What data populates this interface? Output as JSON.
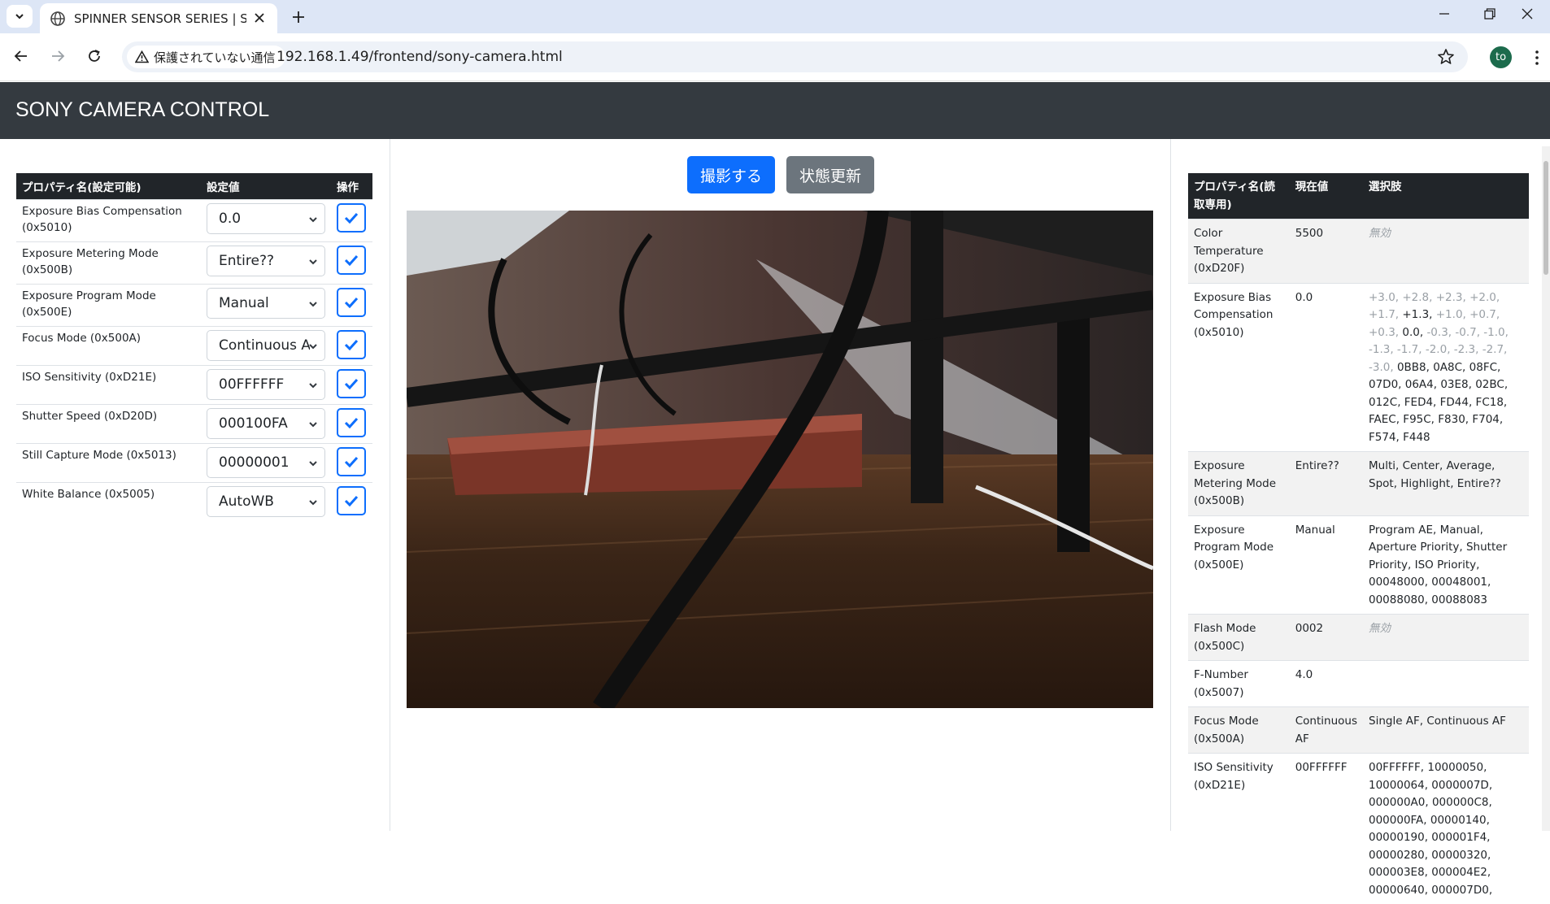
{
  "browser": {
    "tab_title": "SPINNER SENSOR SERIES | SONY CAMERA CONTROL",
    "security_text": "保護されていない通信",
    "url": "192.168.1.49/frontend/sony-camera.html",
    "profile_initials": "to"
  },
  "header": {
    "brand": "SONY CAMERA CONTROL"
  },
  "left_table": {
    "headers": {
      "name": "プロパティ名(設定可能)",
      "value": "設定値",
      "action": "操作"
    },
    "rows": [
      {
        "name": "Exposure Bias Compensation (0x5010)",
        "value": "0.0"
      },
      {
        "name": "Exposure Metering Mode (0x500B)",
        "value": "Entire??"
      },
      {
        "name": "Exposure Program Mode (0x500E)",
        "value": "Manual"
      },
      {
        "name": "Focus Mode (0x500A)",
        "value": "Continuous AF"
      },
      {
        "name": "ISO Sensitivity (0xD21E)",
        "value": "00FFFFFF"
      },
      {
        "name": "Shutter Speed (0xD20D)",
        "value": "000100FA"
      },
      {
        "name": "Still Capture Mode (0x5013)",
        "value": "00000001"
      },
      {
        "name": "White Balance (0x5005)",
        "value": "AutoWB"
      }
    ]
  },
  "buttons": {
    "capture": "撮影する",
    "refresh": "状態更新"
  },
  "right_table": {
    "headers": {
      "name": "プロパティ名(読取専用)",
      "current": "現在値",
      "options": "選択肢"
    },
    "disabled_text": "無効",
    "rows": [
      {
        "name": "Color Temperature (0xD20F)",
        "current": "5500"
      },
      {
        "name": "Exposure Bias Compensation (0x5010)",
        "current": "0.0",
        "options_dim_1": "+3.0, +2.8, +2.3, +2.0, +1.7,",
        "options_norm_1": "+1.3,",
        "options_dim_2": "+1.0, +0.7, +0.3,",
        "options_norm_2": "0.0,",
        "options_dim_3": "-0.3, -0.7, -1.0, -1.3, -1.7, -2.0, -2.3, -2.7, -3.0,",
        "options_norm_3": "0BB8, 0A8C, 08FC, 07D0, 06A4, 03E8, 02BC, 012C, FED4, FD44, FC18, FAEC, F95C, F830, F704, F574, F448"
      },
      {
        "name": "Exposure Metering Mode (0x500B)",
        "current": "Entire??",
        "options": "Multi, Center, Average, Spot, Highlight, Entire??"
      },
      {
        "name": "Exposure Program Mode (0x500E)",
        "current": "Manual",
        "options": "Program AE, Manual, Aperture Priority, Shutter Priority, ISO Priority, 00048000, 00048001, 00088080, 00088083"
      },
      {
        "name": "Flash Mode (0x500C)",
        "current": "0002"
      },
      {
        "name": "F-Number (0x5007)",
        "current": "4.0",
        "options": ""
      },
      {
        "name": "Focus Mode (0x500A)",
        "current": "Continuous AF",
        "options": "Single AF, Continuous AF"
      },
      {
        "name": "ISO Sensitivity (0xD21E)",
        "current": "00FFFFFF",
        "options": "00FFFFFF, 10000050, 10000064, 0000007D, 000000A0, 000000C8, 000000FA, 00000140, 00000190, 000001F4, 00000280, 00000320, 000003E8, 000004E2, 00000640, 000007D0,"
      }
    ]
  }
}
